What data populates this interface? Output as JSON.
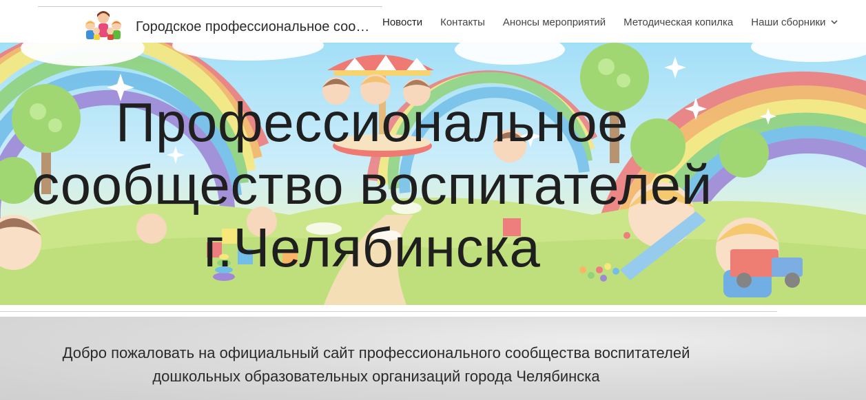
{
  "header": {
    "site_title": "Городское профессиональное сооб...",
    "nav": [
      {
        "label": "Новости"
      },
      {
        "label": "Контакты"
      },
      {
        "label": "Анонсы мероприятий"
      },
      {
        "label": "Методическая копилка"
      },
      {
        "label": "Наши сборники",
        "has_dropdown": true,
        "icon": "chevron-down-icon"
      }
    ],
    "logo_icon": "children-logo-icon"
  },
  "hero": {
    "title_line1": "Профессиональное",
    "title_line2": "сообщество воспитателей",
    "title_line3": "г.Челябинска"
  },
  "welcome": {
    "line1": "Добро пожаловать на официальный сайт профессионального сообщества воспитателей",
    "line2": "дошкольных образовательных организаций города Челябинска"
  },
  "colors": {
    "header_bg": "#ffffff",
    "nav_text": "#444444",
    "hero_title": "#1f1f1f",
    "welcome_bg": "#dcdcdc"
  }
}
